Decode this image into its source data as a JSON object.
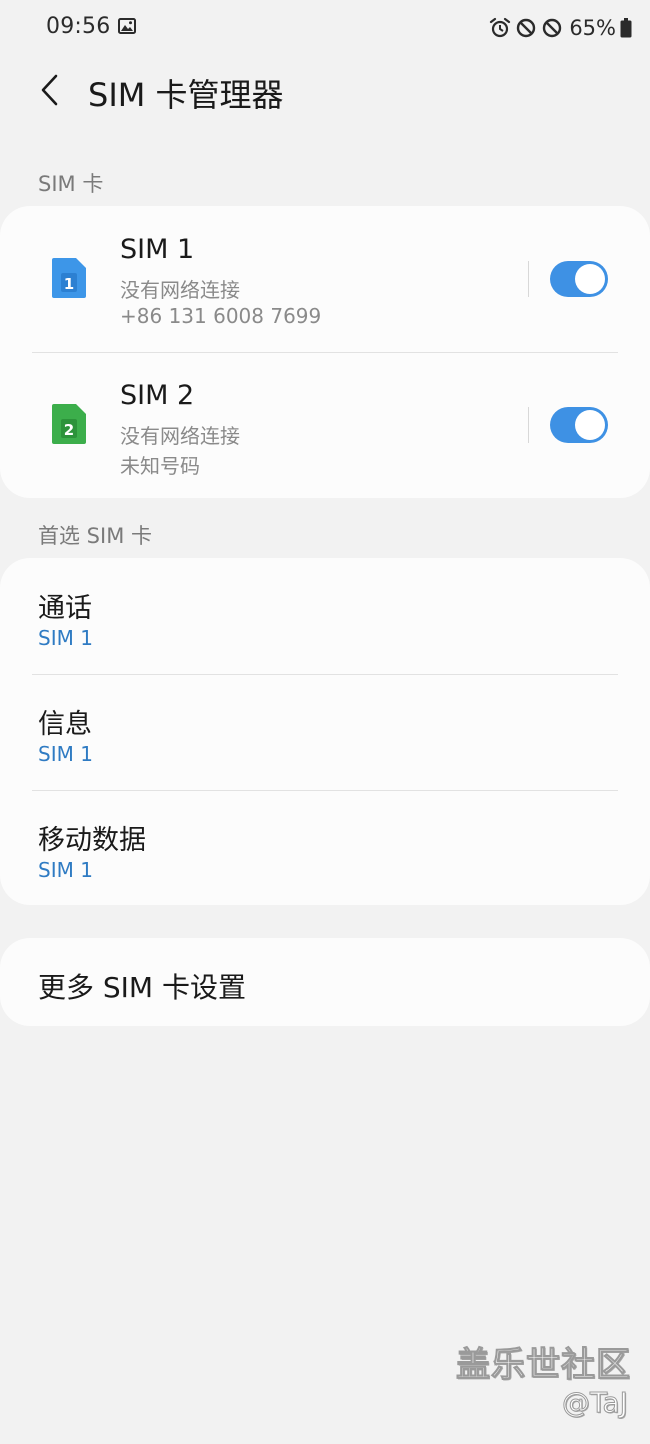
{
  "status_bar": {
    "time": "09:56",
    "battery_percent": "65%",
    "icons": [
      "gallery-icon",
      "alarm-icon",
      "blocked-icon",
      "blocked-icon",
      "battery-icon"
    ]
  },
  "header": {
    "title": "SIM 卡管理器"
  },
  "sim_section": {
    "label": "SIM 卡",
    "cards": [
      {
        "name": "SIM 1",
        "status": "没有网络连接",
        "number": "+86 131 6008 7699",
        "icon_digit": "1",
        "icon_color": "#3d96e8",
        "enabled": true
      },
      {
        "name": "SIM 2",
        "status": "没有网络连接",
        "number": "未知号码",
        "icon_digit": "2",
        "icon_color": "#3cae4b",
        "enabled": true
      }
    ]
  },
  "preferred_section": {
    "label": "首选 SIM 卡",
    "items": [
      {
        "title": "通话",
        "value": "SIM 1"
      },
      {
        "title": "信息",
        "value": "SIM 1"
      },
      {
        "title": "移动数据",
        "value": "SIM 1"
      }
    ]
  },
  "more_settings": {
    "label": "更多 SIM 卡设置"
  },
  "watermark": {
    "community": "盖乐世社区",
    "handle": "@TaJ"
  },
  "colors": {
    "background": "#f2f2f2",
    "card": "#fcfcfc",
    "accent_blue": "#3e91e4",
    "link_blue": "#2f7bc3"
  }
}
